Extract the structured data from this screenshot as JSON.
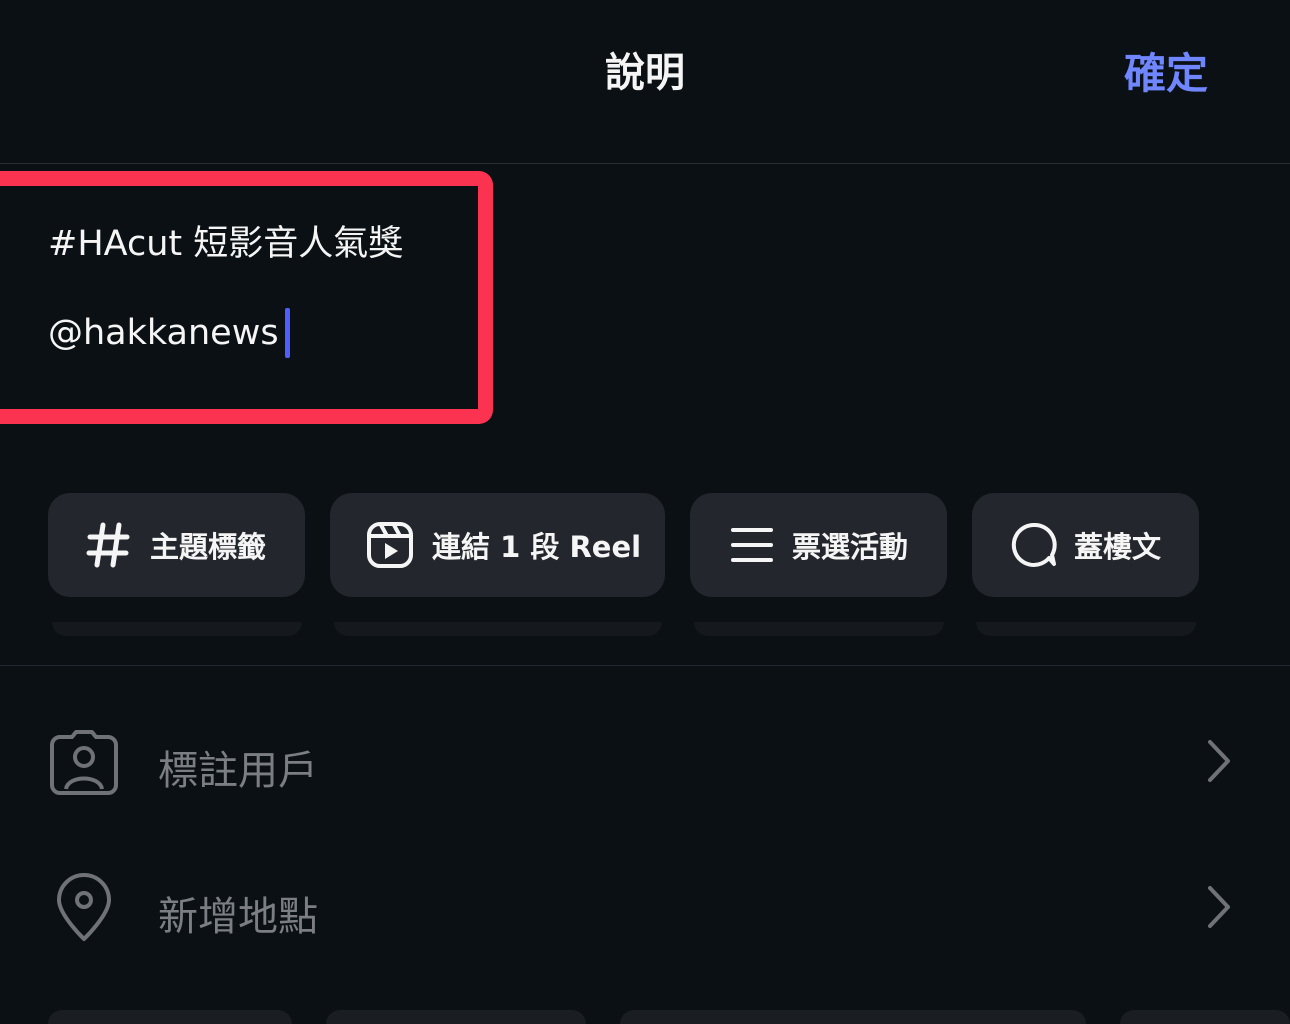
{
  "header": {
    "title": "說明",
    "confirm_label": "確定"
  },
  "caption": {
    "line1": "#HAcut 短影音人氣獎",
    "line2": "@hakkanews"
  },
  "chips": [
    {
      "label": "主題標籤",
      "icon": "hashtag-icon"
    },
    {
      "label": "連結 1 段 Reel",
      "icon": "reel-icon"
    },
    {
      "label": "票選活動",
      "icon": "list-icon"
    },
    {
      "label": "蓋樓文",
      "icon": "chat-bubble-icon"
    }
  ],
  "rows": [
    {
      "label": "標註用戶",
      "icon": "tag-user-icon"
    },
    {
      "label": "新增地點",
      "icon": "location-pin-icon"
    }
  ],
  "colors": {
    "accent": "#6f86ff",
    "highlight": "#fb3250",
    "cursor": "#4f5fff"
  }
}
